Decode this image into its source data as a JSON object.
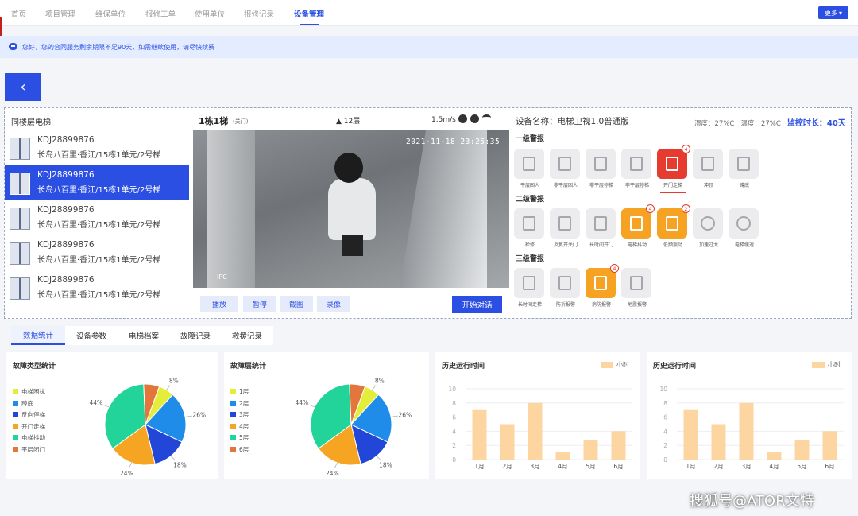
{
  "nav": {
    "items": [
      "首页",
      "项目管理",
      "维保单位",
      "报修工单",
      "使用单位",
      "报修记录",
      "设备管理"
    ],
    "active_index": 6,
    "more_label": "更多"
  },
  "notice": {
    "text": "您好，您的合同服务剩余期限不足90天，如需继续使用，请尽快续费"
  },
  "back": {
    "label": "‹"
  },
  "elevator_list": {
    "title": "同楼层电梯",
    "items": [
      {
        "id": "KDJ28899876",
        "address": "长岛八百里·香江/15栋1单元/2号梯",
        "selected": false
      },
      {
        "id": "KDJ28899876",
        "address": "长岛八百里·香江/15栋1单元/2号梯",
        "selected": true
      },
      {
        "id": "KDJ28899876",
        "address": "长岛八百里·香江/15栋1单元/2号梯",
        "selected": false
      },
      {
        "id": "KDJ28899876",
        "address": "长岛八百里·香江/15栋1单元/2号梯",
        "selected": false
      },
      {
        "id": "KDJ28899876",
        "address": "长岛八百里·香江/15栋1单元/2号梯",
        "selected": false
      }
    ]
  },
  "video": {
    "title": "1栋1梯",
    "door_status": "(关门)",
    "floor": "▲ 12层",
    "speed": "1.5m/s",
    "timestamp": "2021-11-18 23:25:35",
    "camera_label": "IPC",
    "controls": [
      "播放",
      "暂停",
      "截图",
      "录像"
    ],
    "talk_label": "开始对话"
  },
  "device": {
    "name": "设备名称：电梯卫视1.0普通版",
    "humidity": "湿度：27%C",
    "temperature": "温度：27%C",
    "monitor_label": "监控时长：",
    "monitor_value": "40天"
  },
  "alarms": {
    "levels": [
      {
        "title": "一级警报",
        "items": [
          {
            "label": "平层困人",
            "state": "normal",
            "badge": ""
          },
          {
            "label": "非平层困人",
            "state": "normal",
            "badge": ""
          },
          {
            "label": "非平层停梯",
            "state": "normal",
            "badge": ""
          },
          {
            "label": "非平层停梯",
            "state": "normal",
            "badge": ""
          },
          {
            "label": "开门走梯",
            "state": "red",
            "badge": "4"
          },
          {
            "label": "冲顶",
            "state": "normal",
            "badge": ""
          },
          {
            "label": "蹲底",
            "state": "normal",
            "badge": ""
          }
        ]
      },
      {
        "title": "二级警报",
        "items": [
          {
            "label": "检修",
            "state": "normal",
            "badge": ""
          },
          {
            "label": "反复开关门",
            "state": "normal",
            "badge": ""
          },
          {
            "label": "长时间开门",
            "state": "normal",
            "badge": ""
          },
          {
            "label": "电梯抖动",
            "state": "orange",
            "badge": "4"
          },
          {
            "label": "低频震动",
            "state": "orange",
            "badge": "2"
          },
          {
            "label": "加速过大",
            "state": "normal",
            "badge": ""
          },
          {
            "label": "电梯缓速",
            "state": "normal",
            "badge": ""
          }
        ]
      },
      {
        "title": "三级警报",
        "items": [
          {
            "label": "长时间走梯",
            "state": "normal",
            "badge": ""
          },
          {
            "label": "防拆报警",
            "state": "normal",
            "badge": ""
          },
          {
            "label": "消防报警",
            "state": "orange",
            "badge": "4"
          },
          {
            "label": "地震报警",
            "state": "normal",
            "badge": ""
          }
        ]
      }
    ]
  },
  "tabs": {
    "items": [
      "数据统计",
      "设备参数",
      "电梯档案",
      "故障记录",
      "救援记录"
    ],
    "active_index": 0
  },
  "colors": {
    "primary": "#2b4ee3",
    "pie": [
      "#e4ee3a",
      "#1e8ce8",
      "#2246d8",
      "#f6a523",
      "#22d39a",
      "#e3763c"
    ],
    "bar": "#fcd5a1"
  },
  "chart_data": [
    {
      "type": "pie",
      "title": "故障类型统计",
      "categories": [
        "电梯困扰",
        "蹲底",
        "反向停梯",
        "开门走梯",
        "电梯抖动",
        "平层闭门"
      ],
      "values": [
        8,
        26,
        18,
        24,
        44,
        8
      ],
      "labels": [
        "8%",
        "26%",
        "18%",
        "24%",
        "44%",
        ""
      ],
      "legend_position": "left"
    },
    {
      "type": "pie",
      "title": "故障层统计",
      "categories": [
        "1层",
        "2层",
        "3层",
        "4层",
        "5层",
        "6层"
      ],
      "values": [
        8,
        26,
        18,
        24,
        44,
        8
      ],
      "labels": [
        "8%",
        "26%",
        "18%",
        "24%",
        "44%",
        ""
      ],
      "legend_position": "left"
    },
    {
      "type": "bar",
      "title": "历史运行时间",
      "legend": "小时",
      "categories": [
        "1月",
        "2月",
        "3月",
        "4月",
        "5月",
        "6月"
      ],
      "values": [
        7,
        5,
        8,
        1,
        2.8,
        4
      ],
      "ylim": [
        0,
        10
      ],
      "yticks": [
        "0",
        "2",
        "4",
        "6",
        "8",
        "10"
      ],
      "grid": true
    },
    {
      "type": "bar",
      "title": "历史运行时间",
      "legend": "小时",
      "categories": [
        "1月",
        "2月",
        "3月",
        "4月",
        "5月",
        "6月"
      ],
      "values": [
        7,
        5,
        8,
        1,
        2.8,
        4
      ],
      "ylim": [
        0,
        10
      ],
      "yticks": [
        "0",
        "2",
        "4",
        "6",
        "8",
        "10"
      ],
      "grid": true
    }
  ],
  "watermark": "搜狐号@ATOR文特"
}
